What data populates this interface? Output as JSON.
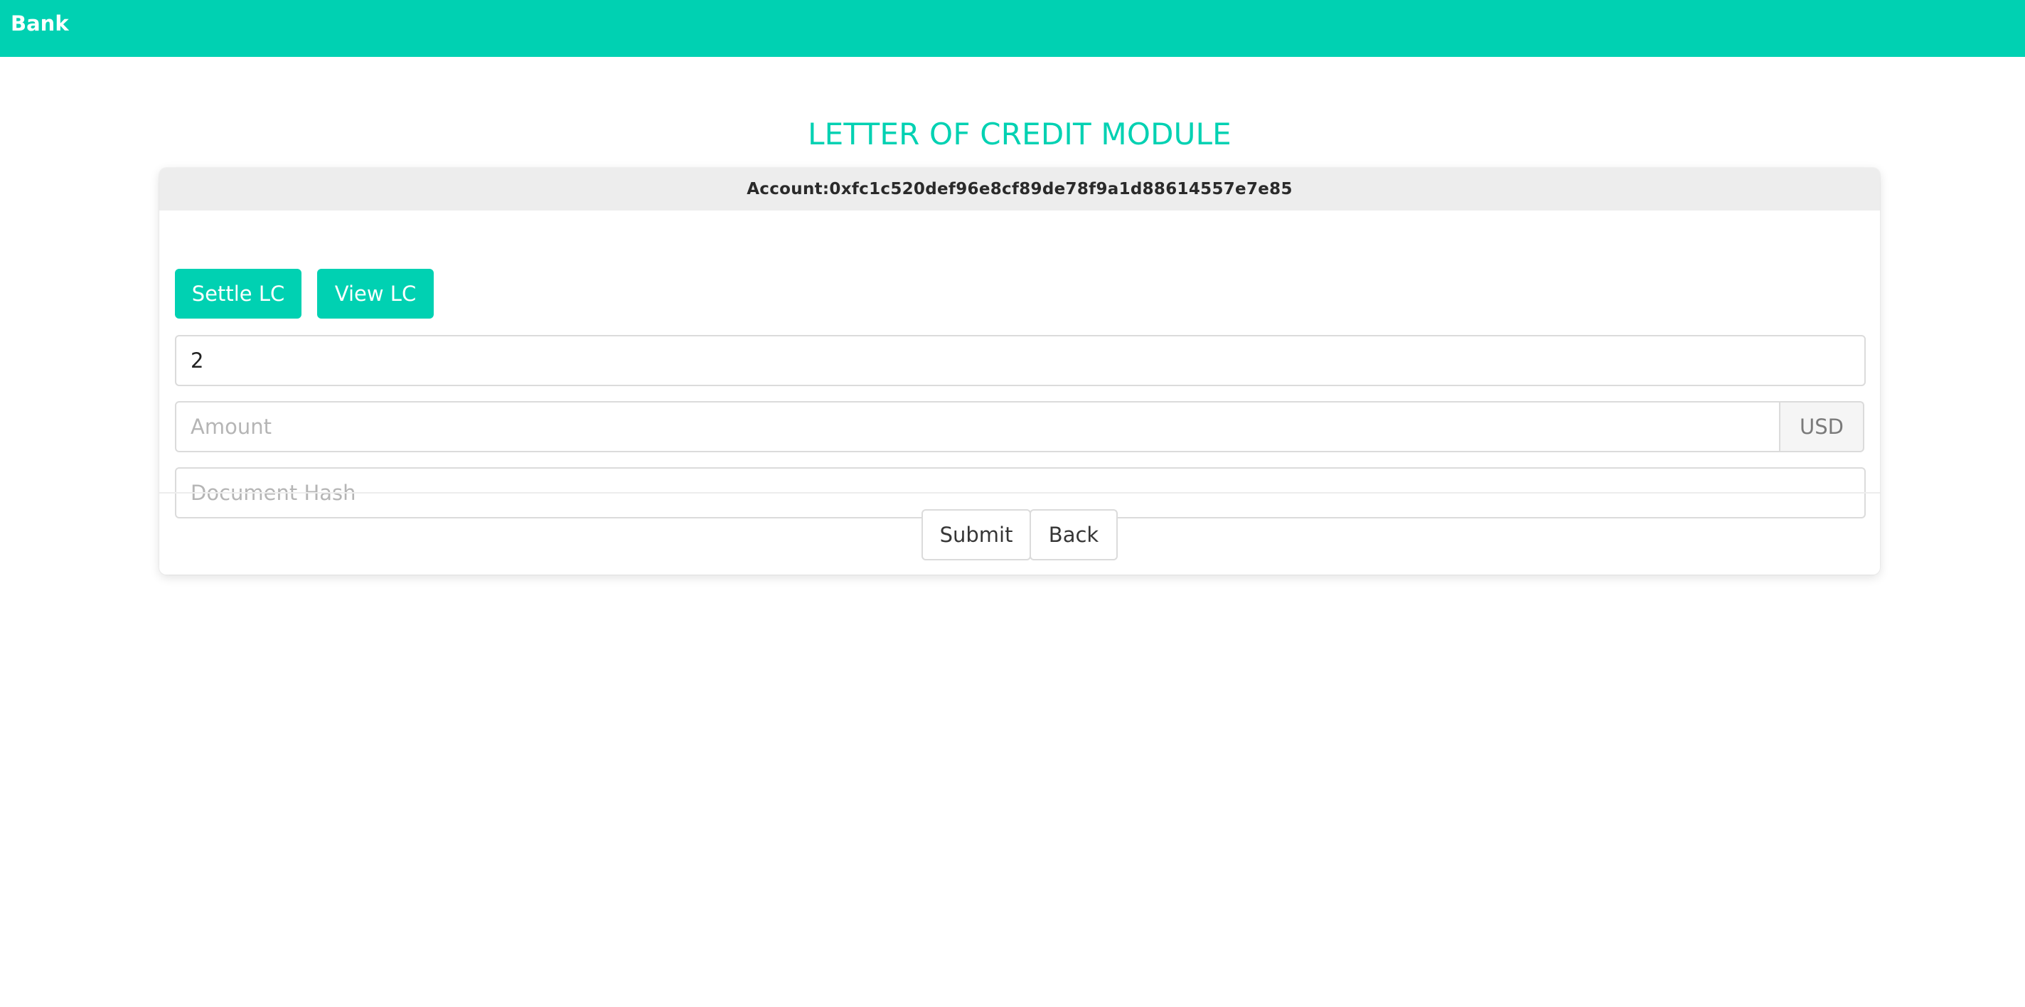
{
  "navbar": {
    "brand": "Bank",
    "color": "#00d1b2"
  },
  "page": {
    "title": "LETTER OF CREDIT MODULE"
  },
  "card": {
    "account_label": "Account:0xfc1c520def96e8cf89de78f9a1d88614557e7e85",
    "actions": {
      "settle_label": "Settle LC",
      "view_label": "View LC"
    },
    "form": {
      "lc_id_value": "2",
      "amount_placeholder": "Amount",
      "amount_value": "",
      "currency": "USD",
      "document_hash_placeholder": "Document Hash",
      "document_hash_value": ""
    },
    "footer": {
      "submit_label": "Submit",
      "back_label": "Back"
    }
  }
}
